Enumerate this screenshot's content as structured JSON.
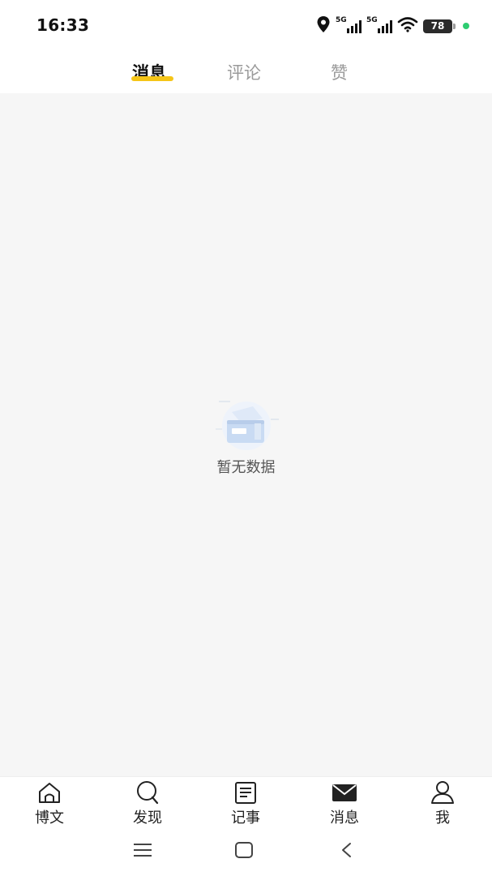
{
  "status_bar": {
    "time": "16:33",
    "network_1": "5G",
    "network_2": "5G",
    "battery": "78",
    "icons": [
      "location-icon",
      "signal-icon",
      "signal-icon",
      "wifi-icon",
      "battery-icon",
      "dot-indicator"
    ]
  },
  "tabs": [
    {
      "label": "消息",
      "active": true
    },
    {
      "label": "评论",
      "active": false
    },
    {
      "label": "赞",
      "active": false
    }
  ],
  "main": {
    "empty_text": "暂无数据"
  },
  "bottom_nav": [
    {
      "label": "博文",
      "icon": "home-icon",
      "active": false
    },
    {
      "label": "发现",
      "icon": "search-icon",
      "active": false
    },
    {
      "label": "记事",
      "icon": "note-icon",
      "active": false
    },
    {
      "label": "消息",
      "icon": "mail-icon",
      "active": true
    },
    {
      "label": "我",
      "icon": "user-icon",
      "active": false
    }
  ],
  "system_nav": {
    "icons": [
      "menu-icon",
      "home-square-icon",
      "back-icon"
    ]
  },
  "colors": {
    "accent": "#f5c518",
    "background": "#f6f6f6",
    "status_dot": "#2ecc71"
  }
}
